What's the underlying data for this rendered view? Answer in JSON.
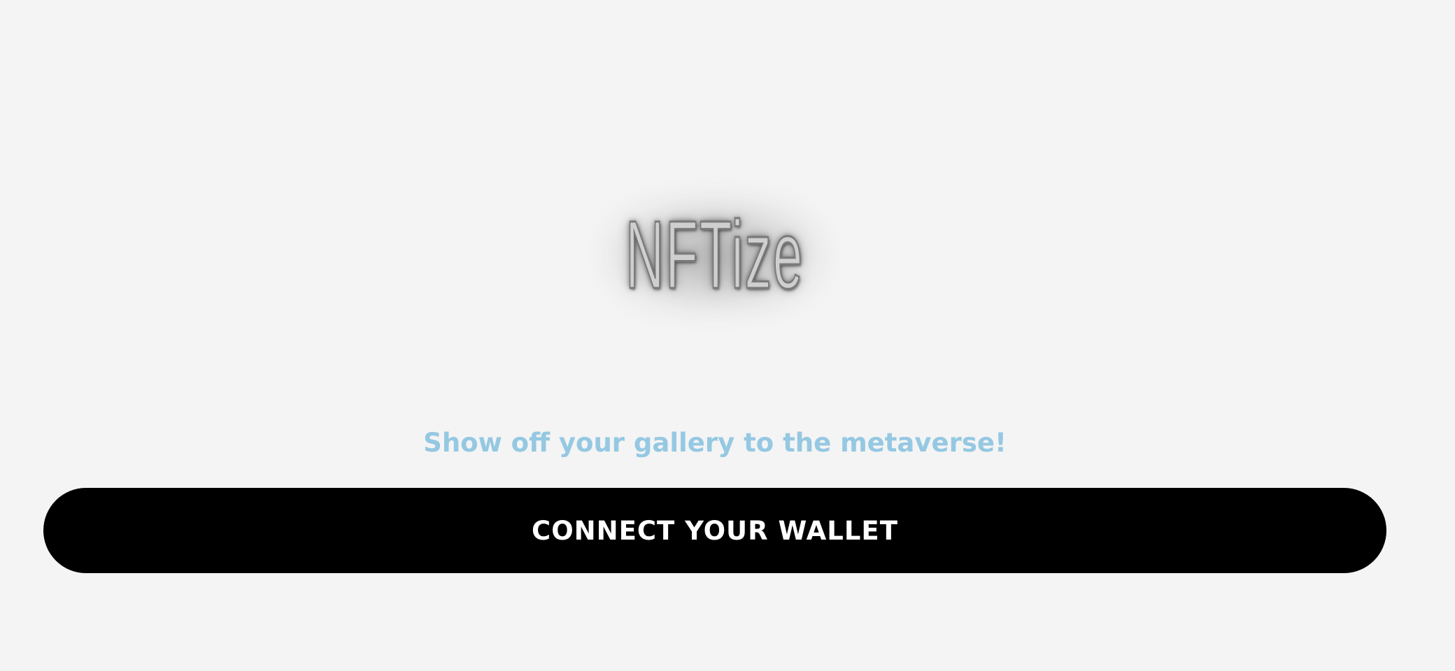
{
  "logo": {
    "text": "NFTize"
  },
  "tagline": "Show off your gallery to the metaverse!",
  "connect_button": {
    "label": "CONNECT YOUR WALLET"
  },
  "colors": {
    "background": "#f4f4f4",
    "tagline": "#95c8e2",
    "button_bg": "#000000",
    "button_text": "#ffffff"
  }
}
